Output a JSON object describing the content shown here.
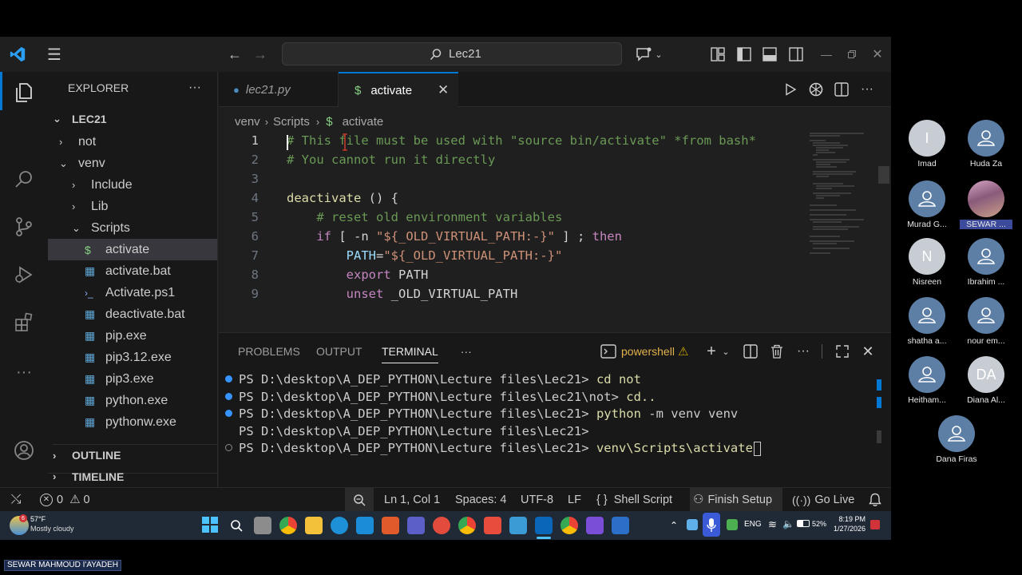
{
  "titlebar": {
    "search_text": "Lec21"
  },
  "explorer": {
    "header": "EXPLORER",
    "root": "LEC21",
    "items": [
      {
        "label": "not",
        "kind": "folder",
        "expanded": false
      },
      {
        "label": "venv",
        "kind": "folder",
        "expanded": true
      },
      {
        "label": "Include",
        "kind": "folder",
        "expanded": false
      },
      {
        "label": "Lib",
        "kind": "folder",
        "expanded": false
      },
      {
        "label": "Scripts",
        "kind": "folder",
        "expanded": true
      },
      {
        "label": "activate",
        "kind": "file",
        "icon": "$"
      },
      {
        "label": "activate.bat",
        "kind": "file"
      },
      {
        "label": "Activate.ps1",
        "kind": "file"
      },
      {
        "label": "deactivate.bat",
        "kind": "file"
      },
      {
        "label": "pip.exe",
        "kind": "file"
      },
      {
        "label": "pip3.12.exe",
        "kind": "file"
      },
      {
        "label": "pip3.exe",
        "kind": "file"
      },
      {
        "label": "python.exe",
        "kind": "file"
      },
      {
        "label": "pythonw.exe",
        "kind": "file"
      }
    ],
    "outline": "OUTLINE",
    "timeline": "TIMELINE"
  },
  "tabs": [
    {
      "label": "lec21.py",
      "active": false
    },
    {
      "label": "activate",
      "active": true
    }
  ],
  "breadcrumb": {
    "parts": [
      "venv",
      "Scripts",
      "activate"
    ]
  },
  "editor": {
    "line_numbers": [
      "1",
      "2",
      "3",
      "4",
      "5",
      "6",
      "7",
      "8",
      "9"
    ],
    "lines": [
      "# This file must be used with \"source bin/activate\" *from bash*",
      "# You cannot run it directly",
      "",
      "deactivate () {",
      "    # reset old environment variables",
      "    if [ -n \"${_OLD_VIRTUAL_PATH:-}\" ] ; then",
      "        PATH=\"${_OLD_VIRTUAL_PATH:-}\"",
      "        export PATH",
      "        unset _OLD_VIRTUAL_PATH"
    ]
  },
  "panel": {
    "tabs": [
      "PROBLEMS",
      "OUTPUT",
      "TERMINAL"
    ],
    "active_tab": "TERMINAL",
    "more": "···",
    "shell_name": "powershell",
    "terminal": [
      {
        "prompt": "PS D:\\desktop\\A_DEP_PYTHON\\Lecture files\\Lec21>",
        "cmd": "cd not",
        "status": "done"
      },
      {
        "prompt": "PS D:\\desktop\\A_DEP_PYTHON\\Lecture files\\Lec21\\not>",
        "cmd": "cd..",
        "status": "done"
      },
      {
        "prompt": "PS D:\\desktop\\A_DEP_PYTHON\\Lecture files\\Lec21>",
        "cmd": "python",
        "args": " -m venv venv",
        "status": "done"
      },
      {
        "prompt": "PS D:\\desktop\\A_DEP_PYTHON\\Lecture files\\Lec21>",
        "cmd": "",
        "status": "none"
      },
      {
        "prompt": "PS D:\\desktop\\A_DEP_PYTHON\\Lecture files\\Lec21>",
        "cmd": "venv\\Scripts\\activate",
        "status": "pending"
      }
    ]
  },
  "statusbar": {
    "errors": "0",
    "warnings": "0",
    "position": "Ln 1, Col 1",
    "spaces": "Spaces: 4",
    "encoding": "UTF-8",
    "eol": "LF",
    "language": "Shell Script",
    "finish_setup": "Finish Setup",
    "go_live": "Go Live"
  },
  "taskbar": {
    "weather_badge": "6",
    "temperature": "57°F",
    "weather": "Mostly cloudy",
    "lang": "ENG",
    "battery": "52%",
    "time": "8:19 PM",
    "date": "1/27/2026"
  },
  "participants": [
    {
      "initial": "I",
      "name": "Imad",
      "type": "initial"
    },
    {
      "initial": "",
      "name": "Huda Za",
      "type": "generic"
    },
    {
      "initial": "",
      "name": "Murad G...",
      "type": "generic"
    },
    {
      "initial": "",
      "name": "SEWAR ...",
      "type": "photo"
    },
    {
      "initial": "N",
      "name": "Nisreen",
      "type": "initial"
    },
    {
      "initial": "",
      "name": "Ibrahim ...",
      "type": "generic"
    },
    {
      "initial": "",
      "name": "shatha a...",
      "type": "generic"
    },
    {
      "initial": "",
      "name": "nour em...",
      "type": "generic"
    },
    {
      "initial": "",
      "name": "Heitham...",
      "type": "generic"
    },
    {
      "initial": "DA",
      "name": "Diana Al...",
      "type": "initial"
    },
    {
      "initial": "",
      "name": "Dana Firas",
      "type": "generic"
    }
  ],
  "presenter_label": "SEWAR MAHMOUD I'AYADEH",
  "colors": {
    "accent": "#0078d4",
    "terminal_cmd": "#dcdcaa",
    "done_dot": "#3794ff",
    "warning": "#cca700"
  }
}
